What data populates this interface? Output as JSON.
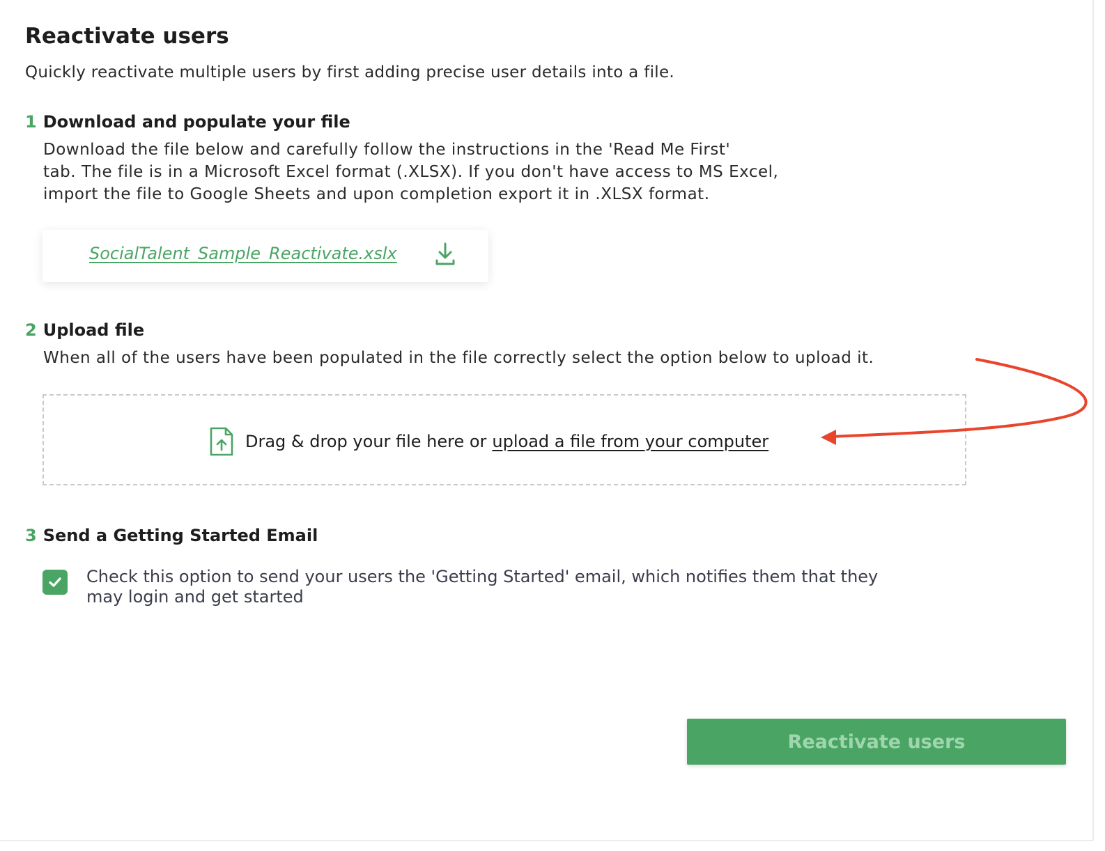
{
  "page": {
    "title": "Reactivate users",
    "subtitle": "Quickly reactivate multiple users by first adding precise user details into a file."
  },
  "steps": [
    {
      "number": "1",
      "heading": "Download and populate your file",
      "description_lines": [
        "Download the file below and carefully follow the instructions in the 'Read Me First'",
        "tab. The file is in a Microsoft Excel format (.XLSX). If you don't have access to MS Excel,",
        "import the file to Google Sheets and upon completion export it in .XLSX format."
      ]
    },
    {
      "number": "2",
      "heading": "Upload file",
      "description": "When all of the users have been populated in the file correctly select the option below to upload it."
    },
    {
      "number": "3",
      "heading": "Send a Getting Started Email"
    }
  ],
  "download": {
    "filename": "SocialTalent_Sample_Reactivate.xslx",
    "icon": "download-icon"
  },
  "dropzone": {
    "icon": "file-upload-icon",
    "text": "Drag & drop your file here or",
    "link": "upload a file from your computer"
  },
  "annotation": {
    "arrow_color": "#e8452c"
  },
  "getting_started": {
    "checked": true,
    "label_line1": "Check this option to send your users the 'Getting Started' email, which notifies them that they",
    "label_line2": "may login and get started"
  },
  "actions": {
    "submit_label": "Reactivate users"
  },
  "colors": {
    "accent": "#4aa564",
    "button_text": "#9fd6ae",
    "text": "#1d1d1d"
  }
}
